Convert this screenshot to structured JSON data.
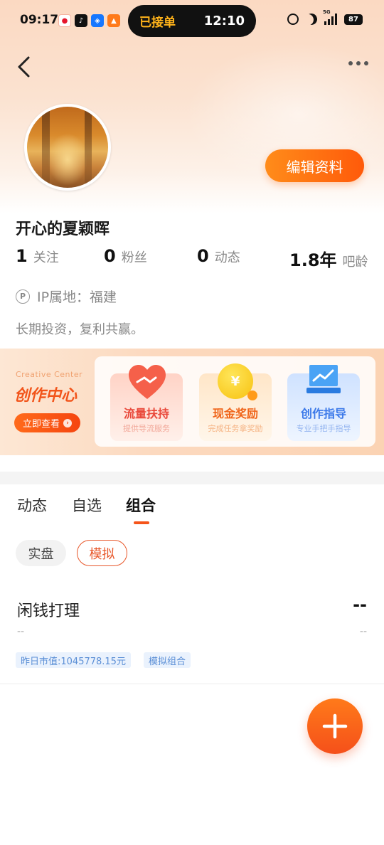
{
  "status_bar": {
    "time": "09:17",
    "island_order": "已接单",
    "island_time": "12:10",
    "network": "5G",
    "battery": "87"
  },
  "profile": {
    "edit_label": "编辑资料",
    "username": "开心的夏颖晖",
    "stats": [
      {
        "num": "1",
        "label": "关注"
      },
      {
        "num": "0",
        "label": "粉丝"
      },
      {
        "num": "0",
        "label": "动态"
      },
      {
        "num": "1.8年",
        "label": "吧龄"
      }
    ],
    "ip_icon": "P",
    "ip_text": "IP属地：福建",
    "bio": "长期投资，复利共赢。"
  },
  "creative_center": {
    "en_title": "Creative Center",
    "cn_title": "创作中心",
    "button_label": "立即查看",
    "cards": [
      {
        "title": "流量扶持",
        "subtitle": "提供导流服务"
      },
      {
        "title": "现金奖励",
        "subtitle": "完成任务拿奖励",
        "icon_glyph": "¥"
      },
      {
        "title": "创作指导",
        "subtitle": "专业手把手指导"
      }
    ]
  },
  "tabs": [
    "动态",
    "自选",
    "组合"
  ],
  "chips": {
    "real": "实盘",
    "sim": "模拟"
  },
  "portfolio": {
    "name": "闲钱打理",
    "value": "--",
    "sub_left": "--",
    "sub_right": "--",
    "tag_value": "昨日市值:1045778.15元",
    "tag_type": "模拟组合"
  },
  "colors": {
    "accent": "#f5541a",
    "button_gradient_start": "#ff8c1a",
    "button_gradient_end": "#ff5a0a"
  }
}
